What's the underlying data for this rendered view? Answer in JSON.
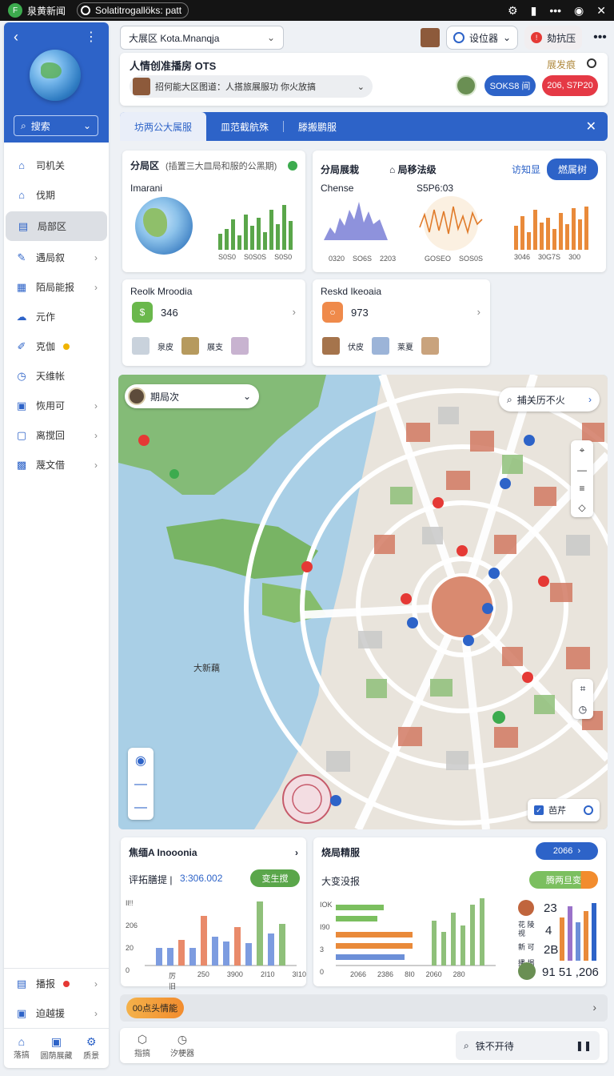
{
  "status_bar": {
    "app_label": "泉黄新闻",
    "tab_label": "Solatitrogallöks: patt"
  },
  "sidebar": {
    "search_label": "搜索",
    "items": [
      {
        "label": "司机关",
        "icon": "house-icon"
      },
      {
        "label": "伐期",
        "icon": "home-icon"
      },
      {
        "label": "局部区",
        "icon": "folder-icon",
        "active": true
      },
      {
        "label": "遇局叙",
        "icon": "pencil-icon",
        "arrow": true
      },
      {
        "label": "陌局能报",
        "icon": "list-icon",
        "arrow": true
      },
      {
        "label": "元作",
        "icon": "cloud-icon"
      },
      {
        "label": "克伽",
        "icon": "pen-icon",
        "badge": true
      },
      {
        "label": "天维帐",
        "icon": "clock-icon"
      },
      {
        "label": "恢用可",
        "icon": "doc-icon",
        "arrow": true
      },
      {
        "label": "离搅回",
        "icon": "box-icon",
        "arrow": true
      },
      {
        "label": "蔑文借",
        "icon": "grid-icon",
        "arrow": true
      }
    ],
    "bottom_items": [
      {
        "label": "播报",
        "badge": true
      },
      {
        "label": "迫越援"
      }
    ],
    "nav": [
      {
        "label": "落搞",
        "icon": "home-icon"
      },
      {
        "label": "圆荫展藏",
        "icon": "doc-icon"
      },
      {
        "label": "质景",
        "icon": "gear-icon"
      }
    ]
  },
  "header": {
    "location": "大展区 Kota.Mnanqja",
    "pill_label": "设位器",
    "alert_label": "劾抗压",
    "title": "人情创准播房 OTS",
    "title_right": "展发痕",
    "subtitle": "招何能大区图道：人搭旅展服功    你火放搞",
    "btn_blue": "SOKS8 间",
    "btn_red": "206, S7P20"
  },
  "tabs": {
    "items": [
      "坊两公大属服",
      "皿范截航殊",
      "滕搬鹏服"
    ]
  },
  "cards": {
    "globe_card": {
      "title": "分局区",
      "sub": "(插置三大皿局和服的公黑期)",
      "label": "Imarani",
      "ticks": [
        "S0S0",
        "S0S0S",
        "S0S0"
      ]
    },
    "wave_card": {
      "title": "分局展栽",
      "title2": "⌂ 局移法级",
      "link": "访知显",
      "btn": "燃属树",
      "label1": "Chense",
      "label2": "S5P6:03",
      "ticks1": [
        "0320",
        "SO6S",
        "2203"
      ],
      "ticks2": [
        "GOSEO",
        "SOS0S"
      ],
      "ticks3": [
        "3046",
        "30G7S",
        "300"
      ]
    },
    "stat1": {
      "title": "Reolk Mroodia",
      "value": "346",
      "row": [
        "泉皮",
        "展支"
      ]
    },
    "stat2": {
      "title": "Reskd Ikeoaia",
      "value": "973",
      "row": [
        "伏皮",
        "莱夏"
      ]
    }
  },
  "map": {
    "select_label": "期局次",
    "search_label": "捕关历不火",
    "area_label": "大新藕",
    "check_label": "芭芹"
  },
  "bottom": {
    "left": {
      "title": "焦缅A Inooonia",
      "sub": "评拓膳提 |",
      "value": "3:306.002",
      "btn": "变生搅",
      "ylabels": [
        "Il!!",
        "206",
        "20",
        "0"
      ],
      "xlabels": [
        "厉旧",
        "250",
        "3900",
        "2I10",
        "3I10"
      ]
    },
    "right": {
      "title": "烧局精服",
      "pill": "2066",
      "sub": "大变没报",
      "btn": "腾两旦变",
      "ylabels": [
        "IOK",
        "I90",
        "3",
        "0"
      ],
      "xlabels": [
        "2066",
        "2386",
        "8I0",
        "2060",
        "280"
      ],
      "nums": [
        "23",
        "4",
        "2B",
        "91 51 ,206"
      ],
      "num_labels": [
        "花 陵 视",
        "新 可",
        "播 揭"
      ]
    }
  },
  "long_bar": {
    "pill": "00点头情能"
  },
  "footer": {
    "items": [
      {
        "label": "指搞",
        "icon": "box-icon"
      },
      {
        "label": "汐梗器",
        "icon": "clock-icon"
      }
    ],
    "search": "铁不开待"
  }
}
